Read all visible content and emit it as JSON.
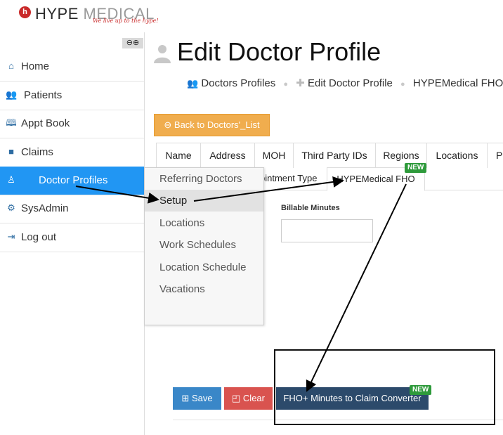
{
  "brand": {
    "name_part1": "HYPE ",
    "name_part2": "MEDICAL",
    "logo_letter": "h",
    "tagline": "We live up to the hype!",
    "accent": "#c92a2a"
  },
  "sidebar": {
    "collapse_label": "⊖⊕",
    "items": [
      {
        "label": "Home",
        "icon": "home-icon"
      },
      {
        "label": "Patients",
        "icon": "users-icon"
      },
      {
        "label": "Appt Book",
        "icon": "book-icon"
      },
      {
        "label": "Claims",
        "icon": "briefcase-icon"
      },
      {
        "label": "Doctor Profiles",
        "icon": "user-doctor-icon",
        "active": true
      },
      {
        "label": "SysAdmin",
        "icon": "gear-icon"
      },
      {
        "label": "Log out",
        "icon": "sign-out-icon"
      }
    ]
  },
  "flyout": {
    "items": [
      "Referring Doctors",
      "Setup",
      "Locations",
      "Work Schedules",
      "Location Schedule",
      "Vacations"
    ],
    "selected": "Setup"
  },
  "page": {
    "title": "Edit Doctor Profile",
    "breadcrumb": [
      "Doctors Profiles",
      "Edit Doctor Profile",
      "HYPEMedical FHO"
    ],
    "back_button": "Back to Doctors'_List"
  },
  "tabs_row1": [
    "Name",
    "Address",
    "MOH",
    "Third Party IDs",
    "Regions",
    "Locations",
    "Pl"
  ],
  "tabs_row2": {
    "partial_label": "pintment Type",
    "active_label": "HYPEMedical FHO",
    "badge": "NEW"
  },
  "form": {
    "billable_label": "Billable Minutes",
    "billable_value": ""
  },
  "actions": {
    "save": "Save",
    "clear": "Clear",
    "converter": "FHO+ Minutes to Claim Converter",
    "converter_badge": "NEW"
  },
  "colors": {
    "active_nav": "#2196f3",
    "back_button": "#f0ad4e",
    "save": "#3a87c8",
    "clear": "#d9534f",
    "converter": "#2c4a6b",
    "badge": "#2e9a3b"
  }
}
